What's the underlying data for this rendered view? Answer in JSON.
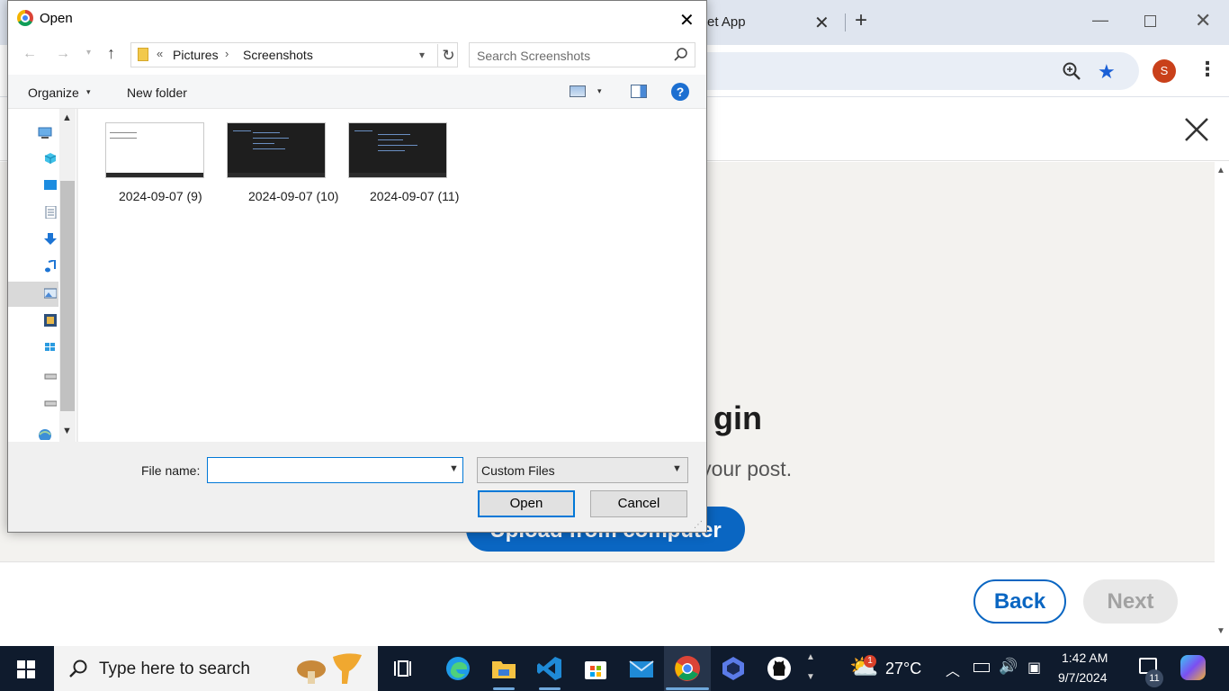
{
  "browser": {
    "tab_title": "et App",
    "tab_close": "✕",
    "new_tab": "+",
    "window_min": "—",
    "window_close": "✕",
    "star": "★",
    "avatar_initial": "S",
    "menu": "⋮"
  },
  "upload_modal": {
    "heading": "gin",
    "subtext": "n your post.",
    "upload_button": "Upload from computer",
    "back_button": "Back",
    "next_button": "Next"
  },
  "dialog": {
    "title": "Open",
    "close": "✕",
    "nav": {
      "back": "←",
      "forward": "→",
      "recent": "▾",
      "up": "↑"
    },
    "address": {
      "chevron": "«",
      "crumbs": [
        "Pictures",
        "Screenshots"
      ],
      "separator": "›",
      "dropdown": "▾",
      "refresh": "↻"
    },
    "search": {
      "placeholder": "Search Screenshots"
    },
    "commands": {
      "organize": "Organize",
      "organize_caret": "▾",
      "new_folder": "New folder",
      "view_caret": "▾",
      "help": "?"
    },
    "files": [
      {
        "name": "2024-09-07 (9)",
        "theme": "light"
      },
      {
        "name": "2024-09-07 (10)",
        "theme": "dark"
      },
      {
        "name": "2024-09-07 (11)",
        "theme": "dark"
      }
    ],
    "file_name_label": "File name:",
    "file_name_value": "",
    "file_type": "Custom Files",
    "open_button": "Open",
    "cancel_button": "Cancel"
  },
  "taskbar": {
    "search_placeholder": "Type here to search",
    "temperature": "27°C",
    "time": "1:42 AM",
    "date": "9/7/2024",
    "notification_count": "11",
    "weather_badge": "1"
  },
  "colors": {
    "accent": "#0a66c2",
    "dialog_focus": "#0078d7",
    "taskbar": "#0f1b2d"
  }
}
